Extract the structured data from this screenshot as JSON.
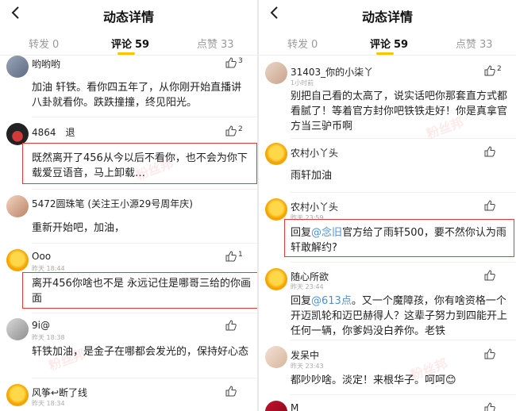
{
  "left": {
    "title": "动态详情",
    "tabs": [
      {
        "label": "转发",
        "count": "0"
      },
      {
        "label": "评论",
        "count": "59"
      },
      {
        "label": "点赞",
        "count": "33"
      }
    ],
    "comments": [
      {
        "name": "哟哟哟",
        "time": "",
        "likes": "3",
        "text": "加油 轩铁。看你四五年了，从你刚开始直播讲八卦就看你。跌跌撞撞，终见阳光。"
      },
      {
        "name": "4864　退",
        "time": "",
        "likes": "2",
        "text": "既然离开了456从今以后不看你，也不会为你下载爱豆语音，马上卸载…"
      },
      {
        "name": "5472圆珠笔 (关注王小源29号周年庆)",
        "time": "",
        "likes": "",
        "text": "重新开始吧，加油，"
      },
      {
        "name": "Ooo",
        "time": "昨天 18:44",
        "likes": "1",
        "text": "离开456你啥也不是 永远记住是哪哥三给的你画面"
      },
      {
        "name": "9i@",
        "time": "昨天 18:38",
        "likes": "",
        "text": "轩铁加油，是金子在哪都会发光的，保持好心态"
      },
      {
        "name": "风筝↩断了线",
        "time": "昨天 18:34",
        "likes": "",
        "text": ""
      }
    ]
  },
  "right": {
    "title": "动态详情",
    "tabs": [
      {
        "label": "转发",
        "count": "0"
      },
      {
        "label": "评论",
        "count": "59"
      },
      {
        "label": "点赞",
        "count": "33"
      }
    ],
    "comments": [
      {
        "name": "31403_你的小柒丫",
        "time": "1小时前",
        "likes": "2",
        "text": "别把自己看的太高了，说实话吧你那套直方式都看腻了！等着官方封你吧铁铁走好！你是真拿官方当三驴币啊"
      },
      {
        "name": "农村小丫头",
        "time": "1小时前",
        "likes": "",
        "text": "雨轩加油"
      },
      {
        "name": "农村小丫头",
        "time": "昨天 23:59",
        "likes": "",
        "reply_prefix": "回复",
        "reply_to": "@念旧",
        "text": "官方给了雨轩500，要不然你认为雨轩敢解约?"
      },
      {
        "name": "随心所欲",
        "time": "昨天 23:44",
        "likes": "",
        "reply_prefix": "回复",
        "reply_to": "@613点",
        "text": "。又一个魔障孩，你有啥资格一个开迈凯轮和迈巴赫得人？这辈子努力到四能开上任何一辆，你爹妈没白养你。老铁"
      },
      {
        "name": "发呆中",
        "time": "昨天 23:43",
        "likes": "",
        "text": "都吵吵啥。淡定！来根华子。呵呵😊"
      },
      {
        "name": "M",
        "time": "",
        "likes": "",
        "text": ""
      }
    ]
  },
  "watermark_text": "粉丝邦",
  "colors": {
    "accent": "#f7c600",
    "highlight_border": "#e23b3b",
    "link": "#4a90d9"
  }
}
